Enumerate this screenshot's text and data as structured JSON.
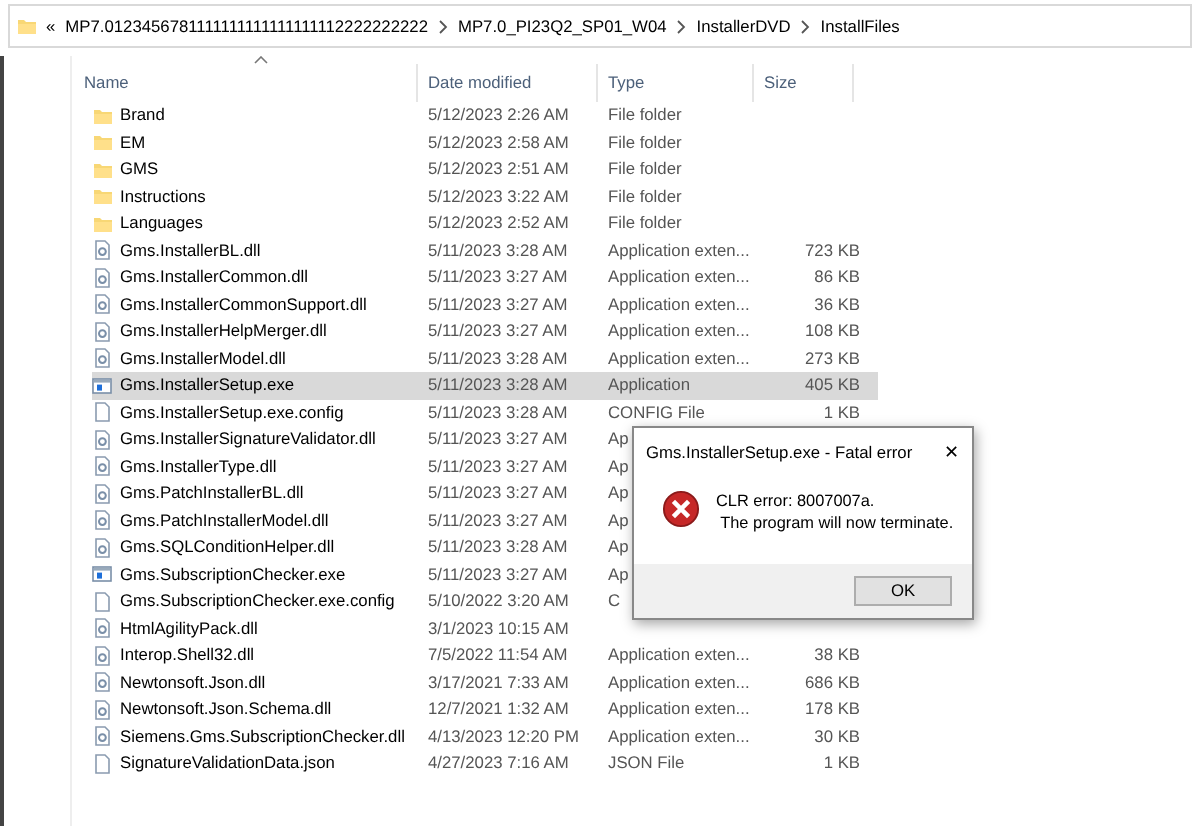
{
  "breadcrumb": {
    "overflow": "«",
    "parts": [
      "MP7.0123456781111111111111111112222222222",
      "MP7.0_PI23Q2_SP01_W04",
      "InstallerDVD",
      "InstallFiles"
    ]
  },
  "columns": [
    "Name",
    "Date modified",
    "Type",
    "Size"
  ],
  "rows": [
    {
      "kind": "folder",
      "name": "Brand",
      "date": "5/12/2023 2:26 AM",
      "type": "File folder",
      "selected": false
    },
    {
      "kind": "folder",
      "name": "EM",
      "date": "5/12/2023 2:58 AM",
      "type": "File folder",
      "selected": false
    },
    {
      "kind": "folder",
      "name": "GMS",
      "date": "5/12/2023 2:51 AM",
      "type": "File folder",
      "selected": false
    },
    {
      "kind": "folder",
      "name": "Instructions",
      "date": "5/12/2023 3:22 AM",
      "type": "File folder",
      "selected": false
    },
    {
      "kind": "folder",
      "name": "Languages",
      "date": "5/12/2023 2:52 AM",
      "type": "File folder",
      "selected": false
    },
    {
      "kind": "dll",
      "name": "Gms.InstallerBL.dll",
      "date": "5/11/2023 3:28 AM",
      "type": "Application exten...",
      "size": "723 KB",
      "selected": false
    },
    {
      "kind": "dll",
      "name": "Gms.InstallerCommon.dll",
      "date": "5/11/2023 3:27 AM",
      "type": "Application exten...",
      "size": "86 KB",
      "selected": false
    },
    {
      "kind": "dll",
      "name": "Gms.InstallerCommonSupport.dll",
      "date": "5/11/2023 3:27 AM",
      "type": "Application exten...",
      "size": "36 KB",
      "selected": false
    },
    {
      "kind": "dll",
      "name": "Gms.InstallerHelpMerger.dll",
      "date": "5/11/2023 3:27 AM",
      "type": "Application exten...",
      "size": "108 KB",
      "selected": false
    },
    {
      "kind": "dll",
      "name": "Gms.InstallerModel.dll",
      "date": "5/11/2023 3:28 AM",
      "type": "Application exten...",
      "size": "273 KB",
      "selected": false
    },
    {
      "kind": "exe",
      "name": "Gms.InstallerSetup.exe",
      "date": "5/11/2023 3:28 AM",
      "type": "Application",
      "size": "405 KB",
      "selected": true
    },
    {
      "kind": "file",
      "name": "Gms.InstallerSetup.exe.config",
      "date": "5/11/2023 3:28 AM",
      "type": "CONFIG File",
      "size": "1 KB",
      "selected": false
    },
    {
      "kind": "dll",
      "name": "Gms.InstallerSignatureValidator.dll",
      "date": "5/11/2023 3:27 AM",
      "type": "Ap",
      "selected": false
    },
    {
      "kind": "dll",
      "name": "Gms.InstallerType.dll",
      "date": "5/11/2023 3:27 AM",
      "type": "Ap",
      "selected": false
    },
    {
      "kind": "dll",
      "name": "Gms.PatchInstallerBL.dll",
      "date": "5/11/2023 3:27 AM",
      "type": "Ap",
      "selected": false
    },
    {
      "kind": "dll",
      "name": "Gms.PatchInstallerModel.dll",
      "date": "5/11/2023 3:27 AM",
      "type": "Ap",
      "selected": false
    },
    {
      "kind": "dll",
      "name": "Gms.SQLConditionHelper.dll",
      "date": "5/11/2023 3:28 AM",
      "type": "Ap",
      "selected": false
    },
    {
      "kind": "exe",
      "name": "Gms.SubscriptionChecker.exe",
      "date": "5/11/2023 3:27 AM",
      "type": "Ap",
      "selected": false
    },
    {
      "kind": "file",
      "name": "Gms.SubscriptionChecker.exe.config",
      "date": "5/10/2022 3:20 AM",
      "type": "C",
      "selected": false
    },
    {
      "kind": "dll",
      "name": "HtmlAgilityPack.dll",
      "date": "3/1/2023 10:15 AM",
      "selected": false
    },
    {
      "kind": "dll",
      "name": "Interop.Shell32.dll",
      "date": "7/5/2022 11:54 AM",
      "type": "Application exten...",
      "size": "38 KB",
      "selected": false
    },
    {
      "kind": "dll",
      "name": "Newtonsoft.Json.dll",
      "date": "3/17/2021 7:33 AM",
      "type": "Application exten...",
      "size": "686 KB",
      "selected": false
    },
    {
      "kind": "dll",
      "name": "Newtonsoft.Json.Schema.dll",
      "date": "12/7/2021 1:32 AM",
      "type": "Application exten...",
      "size": "178 KB",
      "selected": false
    },
    {
      "kind": "dll",
      "name": "Siemens.Gms.SubscriptionChecker.dll",
      "date": "4/13/2023 12:20 PM",
      "type": "Application exten...",
      "size": "30 KB",
      "selected": false
    },
    {
      "kind": "file",
      "name": "SignatureValidationData.json",
      "date": "4/27/2023 7:16 AM",
      "type": "JSON File",
      "size": "1 KB",
      "selected": false
    }
  ],
  "dialog": {
    "title": "Gms.InstallerSetup.exe - Fatal error",
    "close": "✕",
    "message": [
      "CLR error: 8007007a.",
      " The program will now terminate."
    ],
    "button": "OK"
  }
}
